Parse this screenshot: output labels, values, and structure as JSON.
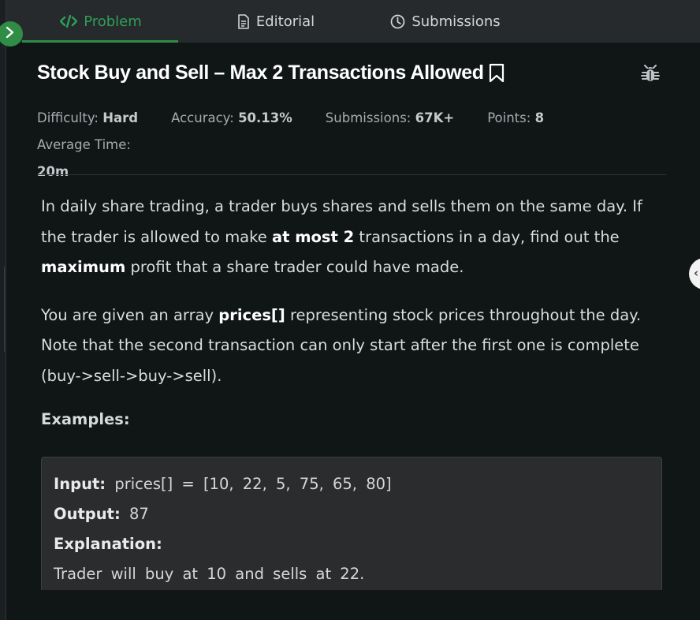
{
  "tabs": {
    "problem": "Problem",
    "editorial": "Editorial",
    "submissions": "Submissions"
  },
  "problem": {
    "title": "Stock Buy and Sell – Max 2 Transactions Allowed"
  },
  "meta": {
    "difficulty_label": "Difficulty:",
    "difficulty_value": "Hard",
    "accuracy_label": "Accuracy:",
    "accuracy_value": "50.13%",
    "submissions_label": "Submissions:",
    "submissions_value": "67K+",
    "points_label": "Points:",
    "points_value": "8",
    "avg_time_label": "Average Time:",
    "avg_time_value": "20m"
  },
  "description": {
    "p1_a": "In daily share trading, a trader buys shares and sells them on the same day. If the trader is allowed to make ",
    "p1_b": "at most 2",
    "p1_c": " transactions in a day, find out the ",
    "p1_d": "maximum",
    "p1_e": " profit that a share trader could have made.",
    "p2_a": "You are given an array ",
    "p2_b": "prices[]",
    "p2_c": " representing stock prices throughout the day. Note that the second transaction can only start after the first one is complete (buy->sell->buy->sell)."
  },
  "examples": {
    "heading": "Examples:",
    "input_label": "Input:",
    "input_value": "prices[] = [10, 22, 5, 75, 65, 80]",
    "output_label": "Output:",
    "output_value": "87",
    "explanation_label": "Explanation:",
    "explanation_line1": "Trader will buy at 10 and sells at 22."
  },
  "icons": {
    "problem_tab": "code-icon",
    "editorial_tab": "document-icon",
    "submissions_tab": "clock-icon",
    "bookmark": "bookmark-icon",
    "report": "bug-icon",
    "expand": "chevron-right-icon"
  },
  "colors": {
    "accent": "#2f8d46",
    "background": "#101516",
    "tabbar": "#262a2d"
  }
}
